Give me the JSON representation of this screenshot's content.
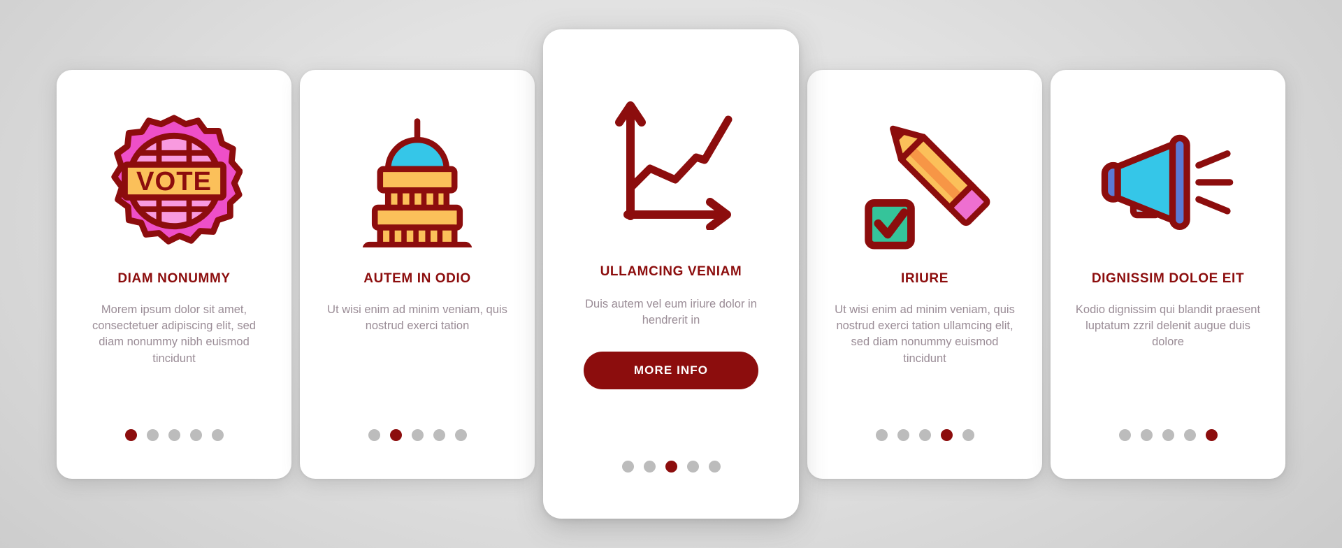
{
  "theme": {
    "accent": "#8c0d0d",
    "body_text": "#9a8c96",
    "dot_inactive": "#bcbcbc",
    "card_bg": "#ffffff",
    "page_bg": "#d8d8d8"
  },
  "cards": [
    {
      "icon": "vote-badge-icon",
      "title": "DIAM NONUMMY",
      "body": "Morem ipsum dolor sit amet, consectetuer adipiscing elit, sed diam nonummy nibh euismod tincidunt",
      "dots": {
        "count": 5,
        "active": 1
      },
      "featured": false,
      "button": null
    },
    {
      "icon": "capitol-building-icon",
      "title": "AUTEM IN ODIO",
      "body": "Ut wisi enim ad minim veniam, quis nostrud exerci tation",
      "dots": {
        "count": 5,
        "active": 2
      },
      "featured": false,
      "button": null
    },
    {
      "icon": "growth-chart-icon",
      "title": "ULLAMCING VENIAM",
      "body": "Duis autem vel eum iriure dolor in hendrerit in",
      "dots": {
        "count": 5,
        "active": 3
      },
      "featured": true,
      "button": "MORE INFO"
    },
    {
      "icon": "pencil-checkbox-icon",
      "title": "IRIURE",
      "body": "Ut wisi enim ad minim veniam, quis nostrud exerci tation ullamcing elit, sed diam nonummy euismod tincidunt",
      "dots": {
        "count": 5,
        "active": 4
      },
      "featured": false,
      "button": null
    },
    {
      "icon": "megaphone-icon",
      "title": "DIGNISSIM DOLOE EIT",
      "body": "Kodio dignissim qui blandit praesent luptatum zzril delenit augue duis dolore",
      "dots": {
        "count": 5,
        "active": 5
      },
      "featured": false,
      "button": null
    }
  ],
  "icon_colors": {
    "outline": "#8c0d0d",
    "pink": "#ee4fc8",
    "pink_light": "#f89adf",
    "orange": "#fbc05a",
    "orange_deep": "#f79646",
    "cyan": "#35c6e8",
    "blue": "#5b7ad4",
    "blue_pale": "#b9d4e8",
    "green": "#35c49a",
    "pink_eraser": "#ee6fd0"
  }
}
